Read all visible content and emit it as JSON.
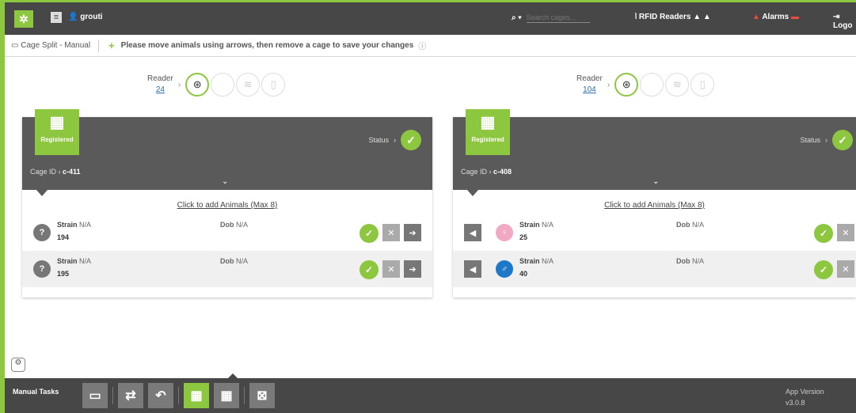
{
  "topbar": {
    "user": "grouti",
    "search_placeholder": "Search cages...",
    "rfid_label": "RFID Readers",
    "alarms_label": "Alarms",
    "logout_label": "Logo"
  },
  "infobar": {
    "breadcrumb": "Cage Split - Manual",
    "message": "Please move animals using arrows, then remove a cage to save your changes"
  },
  "readers": [
    {
      "label": "Reader",
      "id": "24"
    },
    {
      "label": "Reader",
      "id": "104"
    }
  ],
  "cages": [
    {
      "badge": "Registered",
      "status_label": "Status",
      "cage_id_label": "Cage ID",
      "cage_id": "c-411",
      "add_link": "Click to add Animals (Max 8)",
      "animals": [
        {
          "strain_label": "Strain",
          "strain": "N/A",
          "number": "194",
          "dob_label": "Dob",
          "dob": "N/A",
          "sex": "unknown"
        },
        {
          "strain_label": "Strain",
          "strain": "N/A",
          "number": "195",
          "dob_label": "Dob",
          "dob": "N/A",
          "sex": "unknown"
        }
      ]
    },
    {
      "badge": "Registered",
      "status_label": "Status",
      "cage_id_label": "Cage ID",
      "cage_id": "c-408",
      "add_link": "Click to add Animals (Max 8)",
      "animals": [
        {
          "strain_label": "Strain",
          "strain": "N/A",
          "number": "25",
          "dob_label": "Dob",
          "dob": "N/A",
          "sex": "female"
        },
        {
          "strain_label": "Strain",
          "strain": "N/A",
          "number": "40",
          "dob_label": "Dob",
          "dob": "N/A",
          "sex": "male"
        }
      ]
    }
  ],
  "bottombar": {
    "label": "Manual Tasks",
    "version_label": "App Version",
    "version": "v3.0.8"
  },
  "colors": {
    "accent": "#8dc63f",
    "dark": "#474747",
    "female": "#f2a7c3",
    "male": "#1e78c8"
  }
}
